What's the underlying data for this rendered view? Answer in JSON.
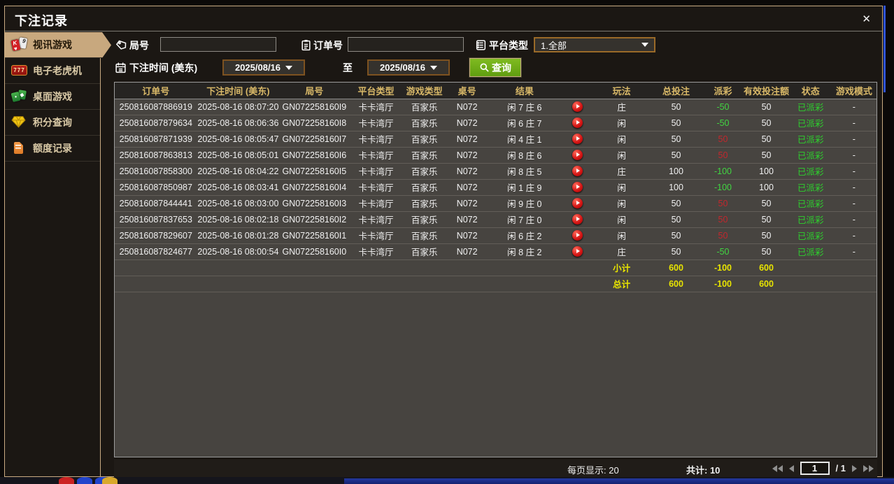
{
  "window": {
    "title": "下注记录",
    "close": "✕"
  },
  "sidebar": {
    "items": [
      {
        "label": "视讯游戏",
        "icon": "cards-icon",
        "active": true
      },
      {
        "label": "电子老虎机",
        "icon": "slot-777-icon",
        "active": false
      },
      {
        "label": "桌面游戏",
        "icon": "table-games-icon",
        "active": false
      },
      {
        "label": "积分查询",
        "icon": "points-diamond-icon",
        "active": false
      },
      {
        "label": "额度记录",
        "icon": "quota-document-icon",
        "active": false
      }
    ]
  },
  "filters": {
    "round_label": "局号",
    "round_value": "",
    "order_label": "订单号",
    "order_value": "",
    "platform_label": "平台类型",
    "platform_value": "1.全部",
    "time_label": "下注时间 (美东)",
    "date_from": "2025/08/16",
    "to_label": "至",
    "date_to": "2025/08/16",
    "search_label": "查询"
  },
  "table": {
    "headers": [
      "订单号",
      "下注时间 (美东)",
      "局号",
      "平台类型",
      "游戏类型",
      "桌号",
      "结果",
      "",
      "玩法",
      "总投注",
      "派彩",
      "有效投注额",
      "状态",
      "游戏模式"
    ],
    "rows": [
      {
        "order": "250816087886919",
        "time": "2025-08-16 08:07:20",
        "round": "GN072258160I9",
        "platform": "卡卡湾厅",
        "game": "百家乐",
        "table_no": "N072",
        "result": "闲 7 庄 6",
        "play_method": "庄",
        "total_bet": "50",
        "payout": "-50",
        "valid_bet": "50",
        "status": "已派彩",
        "mode": "-"
      },
      {
        "order": "250816087879634",
        "time": "2025-08-16 08:06:36",
        "round": "GN072258160I8",
        "platform": "卡卡湾厅",
        "game": "百家乐",
        "table_no": "N072",
        "result": "闲 6 庄 7",
        "play_method": "闲",
        "total_bet": "50",
        "payout": "-50",
        "valid_bet": "50",
        "status": "已派彩",
        "mode": "-"
      },
      {
        "order": "250816087871939",
        "time": "2025-08-16 08:05:47",
        "round": "GN072258160I7",
        "platform": "卡卡湾厅",
        "game": "百家乐",
        "table_no": "N072",
        "result": "闲 4 庄 1",
        "play_method": "闲",
        "total_bet": "50",
        "payout": "50",
        "valid_bet": "50",
        "status": "已派彩",
        "mode": "-"
      },
      {
        "order": "250816087863813",
        "time": "2025-08-16 08:05:01",
        "round": "GN072258160I6",
        "platform": "卡卡湾厅",
        "game": "百家乐",
        "table_no": "N072",
        "result": "闲 8 庄 6",
        "play_method": "闲",
        "total_bet": "50",
        "payout": "50",
        "valid_bet": "50",
        "status": "已派彩",
        "mode": "-"
      },
      {
        "order": "250816087858300",
        "time": "2025-08-16 08:04:22",
        "round": "GN072258160I5",
        "platform": "卡卡湾厅",
        "game": "百家乐",
        "table_no": "N072",
        "result": "闲 8 庄 5",
        "play_method": "庄",
        "total_bet": "100",
        "payout": "-100",
        "valid_bet": "100",
        "status": "已派彩",
        "mode": "-"
      },
      {
        "order": "250816087850987",
        "time": "2025-08-16 08:03:41",
        "round": "GN072258160I4",
        "platform": "卡卡湾厅",
        "game": "百家乐",
        "table_no": "N072",
        "result": "闲 1 庄 9",
        "play_method": "闲",
        "total_bet": "100",
        "payout": "-100",
        "valid_bet": "100",
        "status": "已派彩",
        "mode": "-"
      },
      {
        "order": "250816087844441",
        "time": "2025-08-16 08:03:00",
        "round": "GN072258160I3",
        "platform": "卡卡湾厅",
        "game": "百家乐",
        "table_no": "N072",
        "result": "闲 9 庄 0",
        "play_method": "闲",
        "total_bet": "50",
        "payout": "50",
        "valid_bet": "50",
        "status": "已派彩",
        "mode": "-"
      },
      {
        "order": "250816087837653",
        "time": "2025-08-16 08:02:18",
        "round": "GN072258160I2",
        "platform": "卡卡湾厅",
        "game": "百家乐",
        "table_no": "N072",
        "result": "闲 7 庄 0",
        "play_method": "闲",
        "total_bet": "50",
        "payout": "50",
        "valid_bet": "50",
        "status": "已派彩",
        "mode": "-"
      },
      {
        "order": "250816087829607",
        "time": "2025-08-16 08:01:28",
        "round": "GN072258160I1",
        "platform": "卡卡湾厅",
        "game": "百家乐",
        "table_no": "N072",
        "result": "闲 6 庄 2",
        "play_method": "闲",
        "total_bet": "50",
        "payout": "50",
        "valid_bet": "50",
        "status": "已派彩",
        "mode": "-"
      },
      {
        "order": "250816087824677",
        "time": "2025-08-16 08:00:54",
        "round": "GN072258160I0",
        "platform": "卡卡湾厅",
        "game": "百家乐",
        "table_no": "N072",
        "result": "闲 8 庄 2",
        "play_method": "庄",
        "total_bet": "50",
        "payout": "-50",
        "valid_bet": "50",
        "status": "已派彩",
        "mode": "-"
      }
    ],
    "subtotal": {
      "label": "小计",
      "total_bet": "600",
      "payout": "-100",
      "valid_bet": "600"
    },
    "grand_total": {
      "label": "总计",
      "total_bet": "600",
      "payout": "-100",
      "valid_bet": "600"
    }
  },
  "pagination": {
    "per_page": "每页显示: 20",
    "total": "共计: 10",
    "page": "1",
    "page_total": "/  1"
  },
  "colors": {
    "accent_tan": "#c9ab82",
    "win_green": "#41d541",
    "loss_red": "#c2272d",
    "status_green": "#2dd12d",
    "totals_yellow": "#e8e400",
    "query_green": "#6fae14"
  }
}
